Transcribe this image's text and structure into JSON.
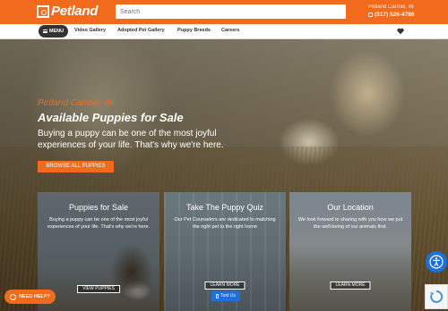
{
  "header": {
    "logo_text": "Petland",
    "search_placeholder": "Search",
    "store_name": "Petland Carmel, IN",
    "phone": "(317) 526-4786",
    "brand_color": "#f26b1d"
  },
  "nav": {
    "menu_label": "MENU",
    "links": [
      "Video Gallery",
      "Adopted Pet Gallery",
      "Puppy Breeds",
      "Careers"
    ],
    "heart_icon": "heart-icon"
  },
  "hero": {
    "store": "Petland Carmel, IN",
    "title": "Available Puppies for Sale",
    "description": "Buying a puppy can be one of the most joyful experiences of your life. That's why we're here.",
    "cta": "BROWSE ALL PUPPIES",
    "prev_icon": "arrow-left-icon",
    "next_icon": "arrow-right-icon"
  },
  "cards": [
    {
      "title": "Puppies for Sale",
      "text": "Buying a puppy can be one of the most joyful experiences of your life. That's why we're here.",
      "button": "VIEW PUPPIES"
    },
    {
      "title": "Take The Puppy Quiz",
      "text": "Our Pet Counselors are dedicated to matching the right pet to the right home",
      "button": "LEARN MORE"
    },
    {
      "title": "Our Location",
      "text": "We look forward to sharing with you how we put the well-being of our animals first.",
      "button": "LEARN MORE"
    }
  ],
  "widgets": {
    "text_us": "Text Us",
    "need_help": "NEED HELP?",
    "accessibility_icon": "accessibility-icon",
    "recaptcha_icon": "recaptcha-icon"
  }
}
